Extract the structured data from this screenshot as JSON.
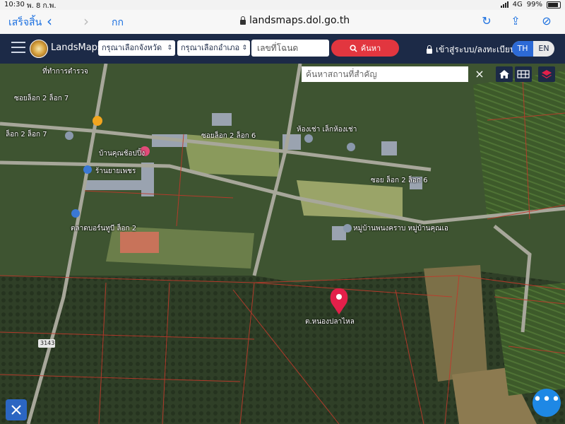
{
  "status_bar": {
    "time": "10:30",
    "date": "พ. 8 ก.พ.",
    "network": "4G",
    "battery": "99%"
  },
  "browser": {
    "done_label": "เสร็จสิ้น",
    "aa_label": "กก",
    "url": "landsmaps.dol.go.th"
  },
  "app": {
    "brand": "LandsMaps",
    "province_select": "กรุณาเลือกจังหวัด",
    "district_select": "กรุณาเลือกอำเภอ",
    "deed_placeholder": "เลขที่โฉนด",
    "search_label": "ค้นหา",
    "login_label": "เข้าสู่ระบบ/ลงทะเบียน",
    "lang_th": "TH",
    "lang_en": "EN",
    "accent": "#e2363f",
    "header_bg": "#1c2a47"
  },
  "map": {
    "place_search_placeholder": "ค้นหาสถานที่สำคัญ",
    "parcel_label": "ต.หนองปลาไหล",
    "road_label": "3143",
    "labels": [
      "ซอยล็อก 2 ล็อก 7",
      "ซอยล็อก 2 ล็อก 6",
      "ล็อก 2 ล็อก 7",
      "ซอย ล็อก 2 ล็อก 6",
      "ห้องเช่า เล็กห้องเช่า",
      "บ้านคุณช้อปปิ้ง",
      "ร้านยายเพชร",
      "ตลาดบอร์นทูบี ล็อก 2",
      "หมู่บ้านพนงคราบ หมู่บ้านคุณเอ",
      "ที่ทำการตำรวจ"
    ]
  }
}
